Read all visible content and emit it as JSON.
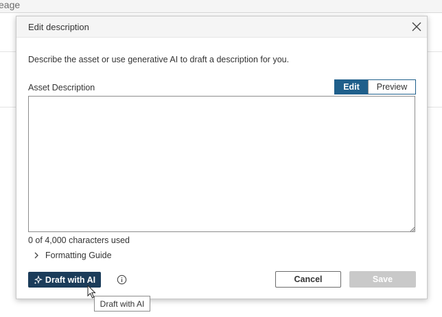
{
  "background": {
    "tab_fragment": "eage"
  },
  "dialog": {
    "title": "Edit description",
    "intro": "Describe the asset or use generative AI to draft a description for you.",
    "field_label": "Asset Description",
    "tabs": [
      {
        "label": "Edit",
        "active": true
      },
      {
        "label": "Preview",
        "active": false
      }
    ],
    "textarea_value": "",
    "char_count": "0 of 4,000 characters used",
    "formatting_guide": "Formatting Guide",
    "draft_button": "Draft with AI",
    "cancel_button": "Cancel",
    "save_button": "Save",
    "save_enabled": false
  },
  "tooltip": {
    "text": "Draft with AI"
  },
  "icons": {
    "close": "close-icon",
    "info": "info-icon",
    "sparkle": "sparkle-icon",
    "chevron": "chevron-right-icon",
    "cursor": "mouse-pointer-icon"
  },
  "colors": {
    "accent": "#1f5f8b",
    "draft_button": "#1b3c5a",
    "disabled_button": "#c9c9c9"
  }
}
